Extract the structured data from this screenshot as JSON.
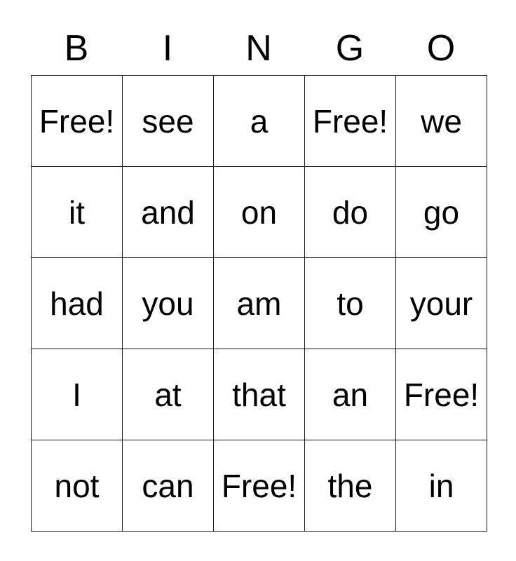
{
  "card": {
    "title": "BINGO",
    "free_space_label": "Free!",
    "columns": 5,
    "rows": 5,
    "text_color": "#000000",
    "border_color": "#1a1a1a",
    "background_color": "#ffffff",
    "header": {
      "letters": [
        "B",
        "I",
        "N",
        "G",
        "O"
      ]
    },
    "grid": [
      [
        "Free!",
        "see",
        "a",
        "Free!",
        "we"
      ],
      [
        "it",
        "and",
        "on",
        "do",
        "go"
      ],
      [
        "had",
        "you",
        "am",
        "to",
        "your"
      ],
      [
        "I",
        "at",
        "that",
        "an",
        "Free!"
      ],
      [
        "not",
        "can",
        "Free!",
        "the",
        "in"
      ]
    ]
  }
}
